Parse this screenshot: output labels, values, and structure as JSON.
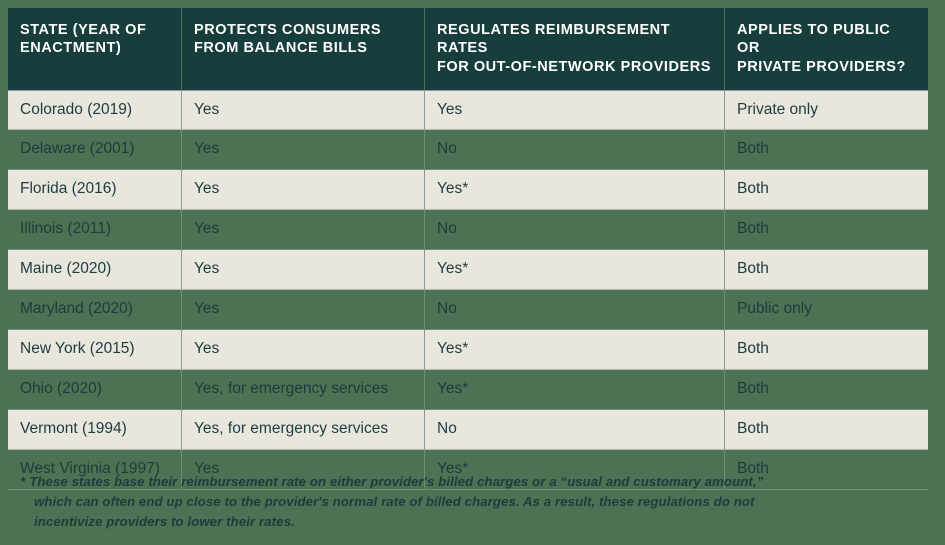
{
  "figure": {
    "name": "state-balance-billing-laws-table",
    "colors": {
      "frame_green": "#4b7253",
      "header_dark_teal": "#173e3c",
      "row_light": "#e9e6de",
      "row_green": "#4b7253",
      "text_dark": "#1d3c3e",
      "header_text": "#ffffff",
      "grid_line": "#8a99a0"
    }
  },
  "table": {
    "columns": [
      {
        "key": "state",
        "label_line1": "STATE (YEAR OF",
        "label_line2": "ENACTMENT)"
      },
      {
        "key": "protect",
        "label_line1": "PROTECTS CONSUMERS",
        "label_line2": "FROM BALANCE BILLS"
      },
      {
        "key": "regs",
        "label_line1": "REGULATES REIMBURSEMENT RATES",
        "label_line2": "FOR OUT-OF-NETWORK PROVIDERS"
      },
      {
        "key": "applies",
        "label_line1": "APPLIES TO PUBLIC OR",
        "label_line2": "PRIVATE PROVIDERS?"
      }
    ],
    "rows": [
      {
        "state": "Colorado (2019)",
        "protect": "Yes",
        "regs": "Yes",
        "applies": "Private only",
        "shade": "light"
      },
      {
        "state": "Delaware (2001)",
        "protect": "Yes",
        "regs": "No",
        "applies": "Both",
        "shade": "green"
      },
      {
        "state": "Florida (2016)",
        "protect": "Yes",
        "regs": "Yes*",
        "applies": "Both",
        "shade": "light"
      },
      {
        "state": "Illinois (2011)",
        "protect": "Yes",
        "regs": "No",
        "applies": "Both",
        "shade": "green"
      },
      {
        "state": "Maine (2020)",
        "protect": "Yes",
        "regs": "Yes*",
        "applies": "Both",
        "shade": "light"
      },
      {
        "state": "Maryland (2020)",
        "protect": "Yes",
        "regs": "No",
        "applies": "Public only",
        "shade": "green"
      },
      {
        "state": "New York (2015)",
        "protect": "Yes",
        "regs": "Yes*",
        "applies": "Both",
        "shade": "light"
      },
      {
        "state": "Ohio (2020)",
        "protect": "Yes, for emergency services",
        "regs": "Yes*",
        "applies": "Both",
        "shade": "green"
      },
      {
        "state": "Vermont (1994)",
        "protect": "Yes, for emergency services",
        "regs": "No",
        "applies": "Both",
        "shade": "light"
      },
      {
        "state": "West Virginia (1997)",
        "protect": "Yes",
        "regs": "Yes*",
        "applies": "Both",
        "shade": "green"
      }
    ]
  },
  "footnote": {
    "marker": "*",
    "line1": "These states base their reimbursement rate on either provider's billed charges or a “usual and customary amount,”",
    "line2": "which can often end up close to the provider's normal rate of billed charges. As a result, these regulations do not",
    "line3": "incentivize providers to lower their rates."
  }
}
